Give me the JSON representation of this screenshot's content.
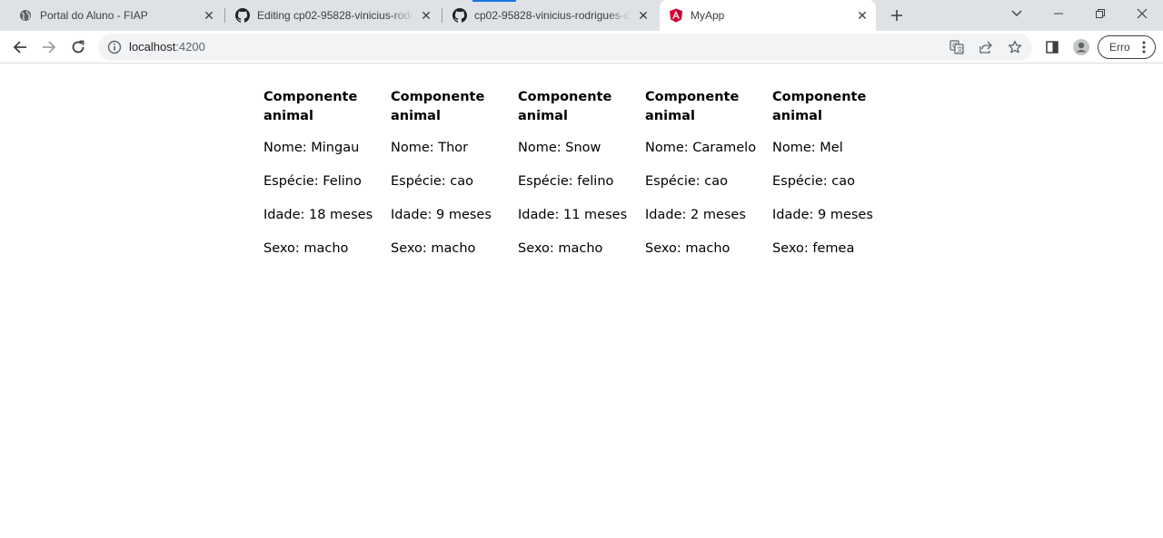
{
  "tabs": [
    {
      "title": "Portal do Aluno - FIAP",
      "icon": "globe-icon",
      "active": false
    },
    {
      "title": "Editing cp02-95828-vinicius-rodrigues",
      "icon": "github-icon",
      "active": false
    },
    {
      "title": "cp02-95828-vinicius-rodrigues-d",
      "icon": "github-icon",
      "active": false
    },
    {
      "title": "MyApp",
      "icon": "angular-icon",
      "active": true
    }
  ],
  "address_bar": {
    "host": "localhost",
    "port": ":4200"
  },
  "profile_button": {
    "label": "Erro"
  },
  "page": {
    "cards": [
      {
        "title": "Componente animal",
        "nome": "Nome: Mingau",
        "especie": "Espécie: Felino",
        "idade": "Idade: 18 meses",
        "sexo": "Sexo: macho"
      },
      {
        "title": "Componente animal",
        "nome": "Nome: Thor",
        "especie": "Espécie: cao",
        "idade": "Idade: 9 meses",
        "sexo": "Sexo: macho"
      },
      {
        "title": "Componente animal",
        "nome": "Nome: Snow",
        "especie": "Espécie: felino",
        "idade": "Idade: 11 meses",
        "sexo": "Sexo: macho"
      },
      {
        "title": "Componente animal",
        "nome": "Nome: Caramelo",
        "especie": "Espécie: cao",
        "idade": "Idade: 2 meses",
        "sexo": "Sexo: macho"
      },
      {
        "title": "Componente animal",
        "nome": "Nome: Mel",
        "especie": "Espécie: cao",
        "idade": "Idade: 9 meses",
        "sexo": "Sexo: femea"
      }
    ]
  },
  "colors": {
    "tabstrip_bg": "#dee1e6",
    "omnibox_bg": "#f1f3f4",
    "loading_accent": "#1a73e8",
    "angular_red": "#dd0031",
    "angular_magenta": "#c3002f"
  }
}
